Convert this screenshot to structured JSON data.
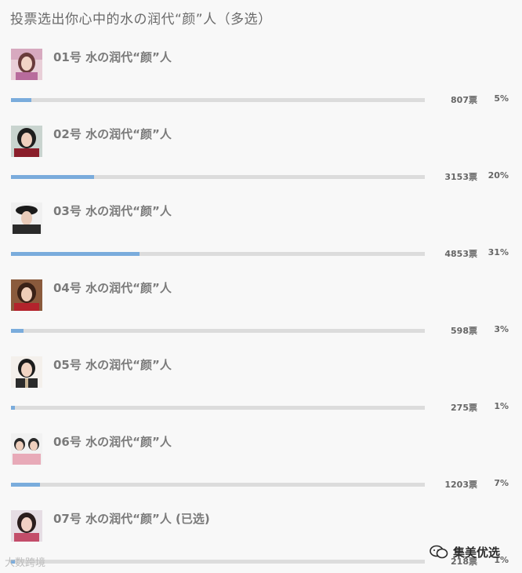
{
  "poll": {
    "title": "投票选出你心中的水の润代“颜”人（多选）",
    "options": [
      {
        "label": "01号 水の润代“颜”人",
        "votes": "807票",
        "percent": "5%",
        "fraction": 0.05
      },
      {
        "label": "02号 水の润代“颜”人",
        "votes": "3153票",
        "percent": "20%",
        "fraction": 0.2
      },
      {
        "label": "03号 水の润代“颜”人",
        "votes": "4853票",
        "percent": "31%",
        "fraction": 0.31
      },
      {
        "label": "04号 水の润代“颜”人",
        "votes": "598票",
        "percent": "3%",
        "fraction": 0.03
      },
      {
        "label": "05号 水の润代“颜”人",
        "votes": "275票",
        "percent": "1%",
        "fraction": 0.01
      },
      {
        "label": "06号 水の润代“颜”人",
        "votes": "1203票",
        "percent": "7%",
        "fraction": 0.07
      },
      {
        "label": "07号 水の润代“颜”人 (已选)",
        "votes": "218票",
        "percent": "1%",
        "fraction": 0.01
      }
    ]
  },
  "colors": {
    "bar_fill": "#7aacdc",
    "bar_track": "#dcdcdc",
    "background": "#f8f8f8"
  },
  "watermarks": {
    "left_text": "大数跨境",
    "right_text": "集美优选",
    "right_icon": "wechat-icon"
  }
}
